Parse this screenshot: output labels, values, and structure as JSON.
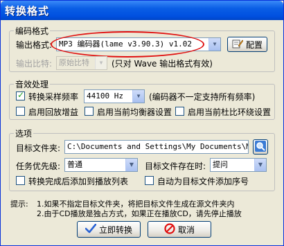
{
  "window": {
    "title": "转换格式"
  },
  "encoding": {
    "legend": "编码格式",
    "format_label": "输出格式:",
    "format_value": "MP3 编码器(lame v3.90.3) v1.02",
    "config_button": "配置",
    "bitrate_label": "输出比特:",
    "bitrate_value": "原始比特",
    "bitrate_note": "(只对 Wave 输出格式有效)"
  },
  "audio": {
    "legend": "音效处理",
    "resample_label": "转换采样频率",
    "resample_checked": true,
    "sample_rate": "44100 Hz",
    "sample_note": "(编码器不一定支持所有频率)",
    "gain_label": "启用回放增益",
    "eq_label": "启用当前均衡器设置",
    "dolby_label": "启用当前杜比环绕设置"
  },
  "options": {
    "legend": "选项",
    "target_folder_label": "目标文件夹:",
    "target_folder_value": "C:\\Documents and Settings\\My Documents\\My Mu",
    "priority_label": "任务优先级:",
    "priority_value": "普通",
    "exists_label": "目标文件存在时:",
    "exists_value": "提问",
    "add_playlist_label": "转换完成后添加到播放列表",
    "add_seq_label": "自动为目标文件添加序号"
  },
  "hints": {
    "prefix": "提示:",
    "line1": "1.如果不指定目标文件夹，将把目标文件生成在源文件夹内",
    "line2": "2.由于CD播放是独占方式，如果正在播放CD，请先停止播放"
  },
  "buttons": {
    "convert": "立即转换",
    "cancel": "取消"
  },
  "colors": {
    "title_bar": "#0054e3",
    "highlight_oval": "#e01010",
    "dialog_bg": "#ece9d8"
  }
}
